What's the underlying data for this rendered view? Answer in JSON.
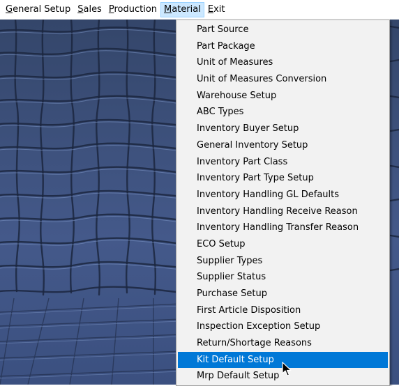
{
  "menubar": {
    "items": [
      {
        "mnemonic": "G",
        "rest": "eneral Setup"
      },
      {
        "mnemonic": "S",
        "rest": "ales"
      },
      {
        "mnemonic": "P",
        "rest": "roduction"
      },
      {
        "mnemonic": "M",
        "rest": "aterial"
      },
      {
        "mnemonic": "E",
        "rest": "xit"
      }
    ],
    "active_index": 3
  },
  "material_menu": {
    "items": [
      "Part Source",
      "Part Package",
      "Unit of Measures",
      "Unit of Measures Conversion",
      "Warehouse Setup",
      "ABC Types",
      "Inventory Buyer Setup",
      "General Inventory Setup",
      "Inventory Part Class",
      "Inventory Part Type Setup",
      "Inventory Handling GL Defaults",
      "Inventory Handling Receive Reason",
      "Inventory Handling Transfer Reason",
      "ECO Setup",
      "Supplier Types",
      "Supplier Status",
      "Purchase Setup",
      "First Article Disposition",
      "Inspection Exception Setup",
      "Return/Shortage Reasons",
      "Kit Default Setup",
      "Mrp Default Setup"
    ],
    "highlighted_index": 20
  },
  "colors": {
    "highlight": "#0078d7",
    "menu_background": "#f2f2f2",
    "desktop_wallpaper": "#3c5178"
  },
  "icons": {
    "cursor": "mouse-pointer-icon"
  }
}
